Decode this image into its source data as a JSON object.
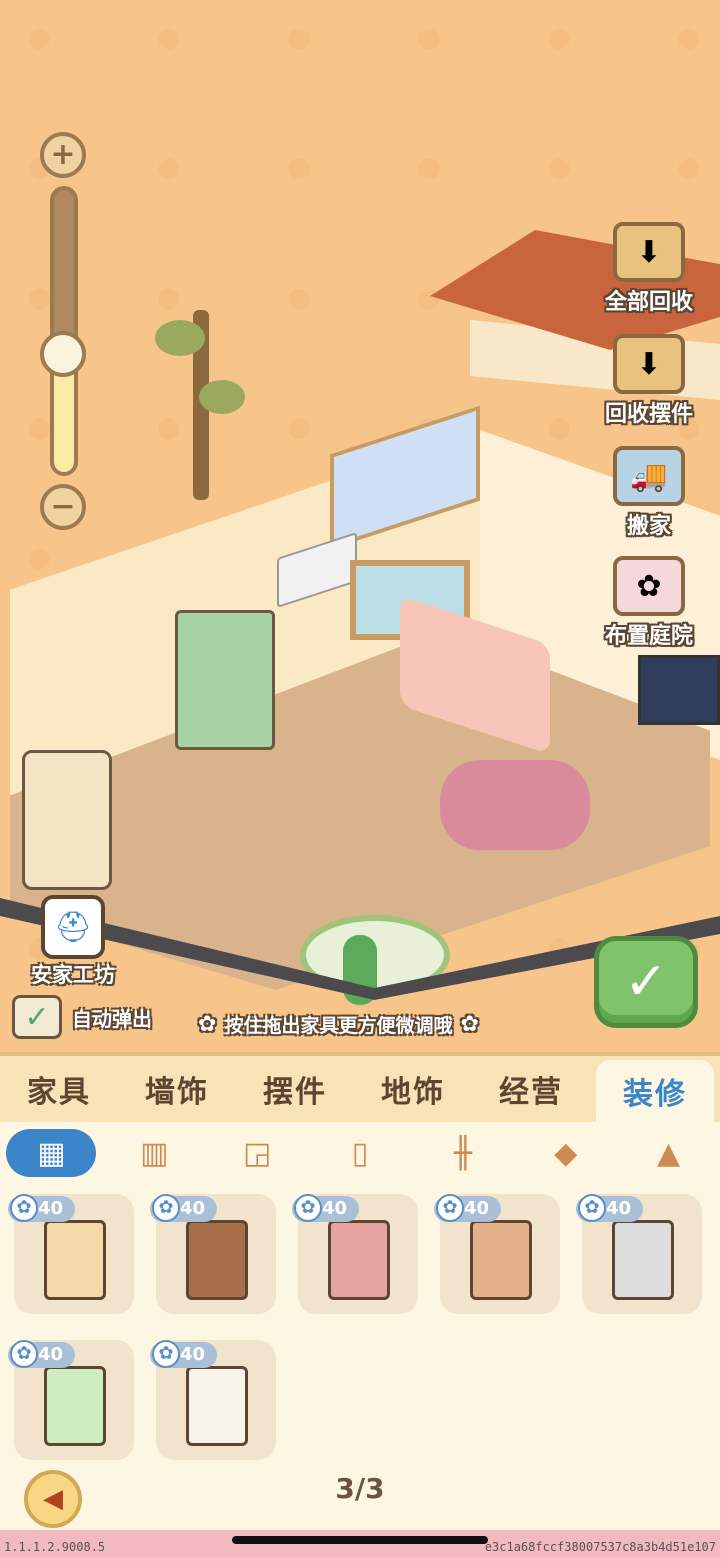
{
  "scene": {
    "actions": [
      {
        "label": "全部回收",
        "icon": "box-down-icon",
        "color": "#e8c37d"
      },
      {
        "label": "回收摆件",
        "icon": "bag-down-icon",
        "color": "#e8c37d"
      },
      {
        "label": "搬家",
        "icon": "truck-icon",
        "color": "#b7d4e6"
      },
      {
        "label": "布置庭院",
        "icon": "flower-wreath-icon",
        "color": "#f4d8dc"
      }
    ],
    "workshop_label": "安家工坊",
    "auto_popup_label": "自动弹出",
    "auto_popup_checked": true,
    "hint": "按住拖出家具更方便微调哦",
    "zoom_level": 0.42
  },
  "tabs": [
    "家具",
    "墙饰",
    "摆件",
    "地饰",
    "经营",
    "装修"
  ],
  "active_tab": 5,
  "subtabs": [
    "grid-icon",
    "wall-icon",
    "window-icon",
    "door-icon",
    "fence-icon",
    "roof-icon",
    "yard-icon"
  ],
  "items": [
    {
      "price": "40",
      "color": "#f3d9a8"
    },
    {
      "price": "40",
      "color": "#a8704a"
    },
    {
      "price": "40",
      "color": "#e4a3a0"
    },
    {
      "price": "40",
      "color": "#e4b28a"
    },
    {
      "price": "40",
      "color": "#dddddd"
    },
    {
      "price": "40",
      "color": "#cfeec0"
    },
    {
      "price": "40",
      "color": "#f7f2ea"
    }
  ],
  "pager": "3/3",
  "version": "1.1.1.2.9008.5",
  "hash": "e3c1a68fccf38007537c8a3b4d51e107"
}
